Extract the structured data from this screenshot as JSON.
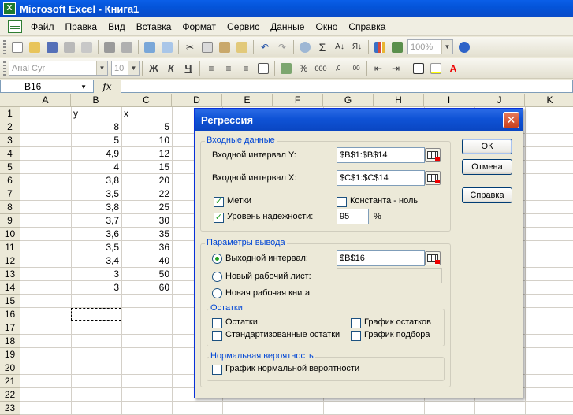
{
  "window": {
    "title": "Microsoft Excel - Книга1",
    "app_icon": "X"
  },
  "menu": [
    "Файл",
    "Правка",
    "Вид",
    "Вставка",
    "Формат",
    "Сервис",
    "Данные",
    "Окно",
    "Справка"
  ],
  "toolbar": {
    "zoom": "100%",
    "font_name": "Arial Cyr",
    "font_size": "10",
    "sum_symbol": "Σ",
    "percent_symbol": "%",
    "bold": "Ж",
    "italic": "К",
    "underline": "Ч"
  },
  "formula_bar": {
    "name_box": "B16",
    "fx_label": "fx",
    "formula": ""
  },
  "sheet": {
    "columns": [
      "A",
      "B",
      "C",
      "D",
      "E",
      "F",
      "G",
      "H",
      "I",
      "J",
      "K"
    ],
    "rows": [
      "1",
      "2",
      "3",
      "4",
      "5",
      "6",
      "7",
      "8",
      "9",
      "10",
      "11",
      "12",
      "13",
      "14",
      "15",
      "16",
      "17",
      "18",
      "19",
      "20",
      "21",
      "22",
      "23"
    ],
    "col_b_header": "y",
    "col_c_header": "x",
    "y_values": [
      "8",
      "5",
      "4,9",
      "4",
      "3,8",
      "3,5",
      "3,8",
      "3,7",
      "3,6",
      "3,5",
      "3,4",
      "3",
      "3"
    ],
    "x_values": [
      "5",
      "10",
      "12",
      "15",
      "20",
      "22",
      "25",
      "30",
      "35",
      "36",
      "40",
      "50",
      "60"
    ],
    "active_cell": "B16"
  },
  "dialog": {
    "title": "Регрессия",
    "input_group": "Входные данные",
    "input_y_label": "Входной интервал Y:",
    "input_y_value": "$B$1:$B$14",
    "input_x_label": "Входной интервал X:",
    "input_x_value": "$C$1:$C$14",
    "labels_check": "Метки",
    "constant_zero_check": "Константа - ноль",
    "confidence_check": "Уровень надежности:",
    "confidence_value": "95",
    "percent": "%",
    "output_group": "Параметры вывода",
    "output_range_label": "Выходной интервал:",
    "output_range_value": "$B$16",
    "new_sheet_label": "Новый рабочий лист:",
    "new_sheet_value": "",
    "new_book_label": "Новая рабочая книга",
    "residuals_group": "Остатки",
    "residuals": "Остатки",
    "std_residuals": "Стандартизованные остатки",
    "residual_plot": "График остатков",
    "fit_plot": "График подбора",
    "normal_group": "Нормальная вероятность",
    "normal_plot": "График нормальной вероятности",
    "ok": "ОК",
    "cancel": "Отмена",
    "help": "Справка"
  }
}
